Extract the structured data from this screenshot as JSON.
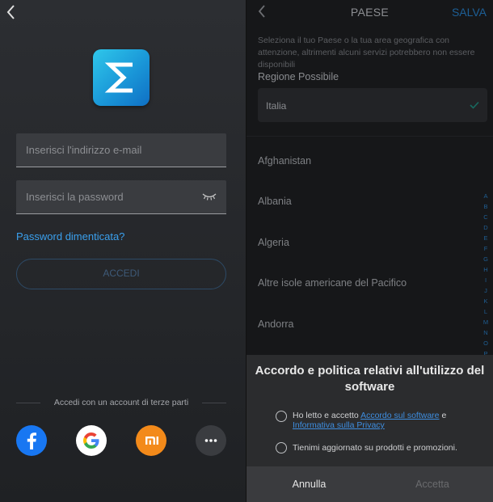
{
  "login": {
    "email_placeholder": "Inserisci l'indirizzo e-mail",
    "password_placeholder": "Inserisci la password",
    "forgot_password": "Password dimenticata?",
    "login_button": "ACCEDI",
    "third_party_text": "Accedi con un account di terze parti",
    "social_icons": [
      "facebook-icon",
      "google-icon",
      "xiaomi-icon",
      "more-icon"
    ]
  },
  "country_page": {
    "title": "PAESE",
    "save_label": "SALVA",
    "description": "Seleziona il tuo Paese o la tua area geografica con attenzione, altrimenti alcuni servizi potrebbero non essere disponibili",
    "region_label": "Regione Possibile",
    "selected_region": "Italia",
    "countries": [
      "Afghanistan",
      "Albania",
      "Algeria",
      "Altre isole americane del Pacifico",
      "Andorra"
    ],
    "alphabet": [
      "A",
      "B",
      "C",
      "D",
      "E",
      "F",
      "G",
      "H",
      "I",
      "J",
      "K",
      "L",
      "M",
      "N",
      "O",
      "P"
    ]
  },
  "dialog": {
    "title": "Accordo e politica relativi all'utilizzo del software",
    "option1_prefix": "Ho letto e accetto ",
    "option1_link1": "Accordo sul software",
    "option1_mid": " e",
    "option1_link2": "Informativa sulla Privacy",
    "option2": "Tienimi aggiornato su prodotti e promozioni.",
    "cancel_label": "Annulla",
    "accept_label": "Accetta"
  },
  "colors": {
    "accent_blue": "#3aa0ee",
    "facebook": "#1877f2",
    "xiaomi": "#f38a1a",
    "logo_gradient_start": "#2fc7ea",
    "logo_gradient_end": "#0f6fc4"
  }
}
